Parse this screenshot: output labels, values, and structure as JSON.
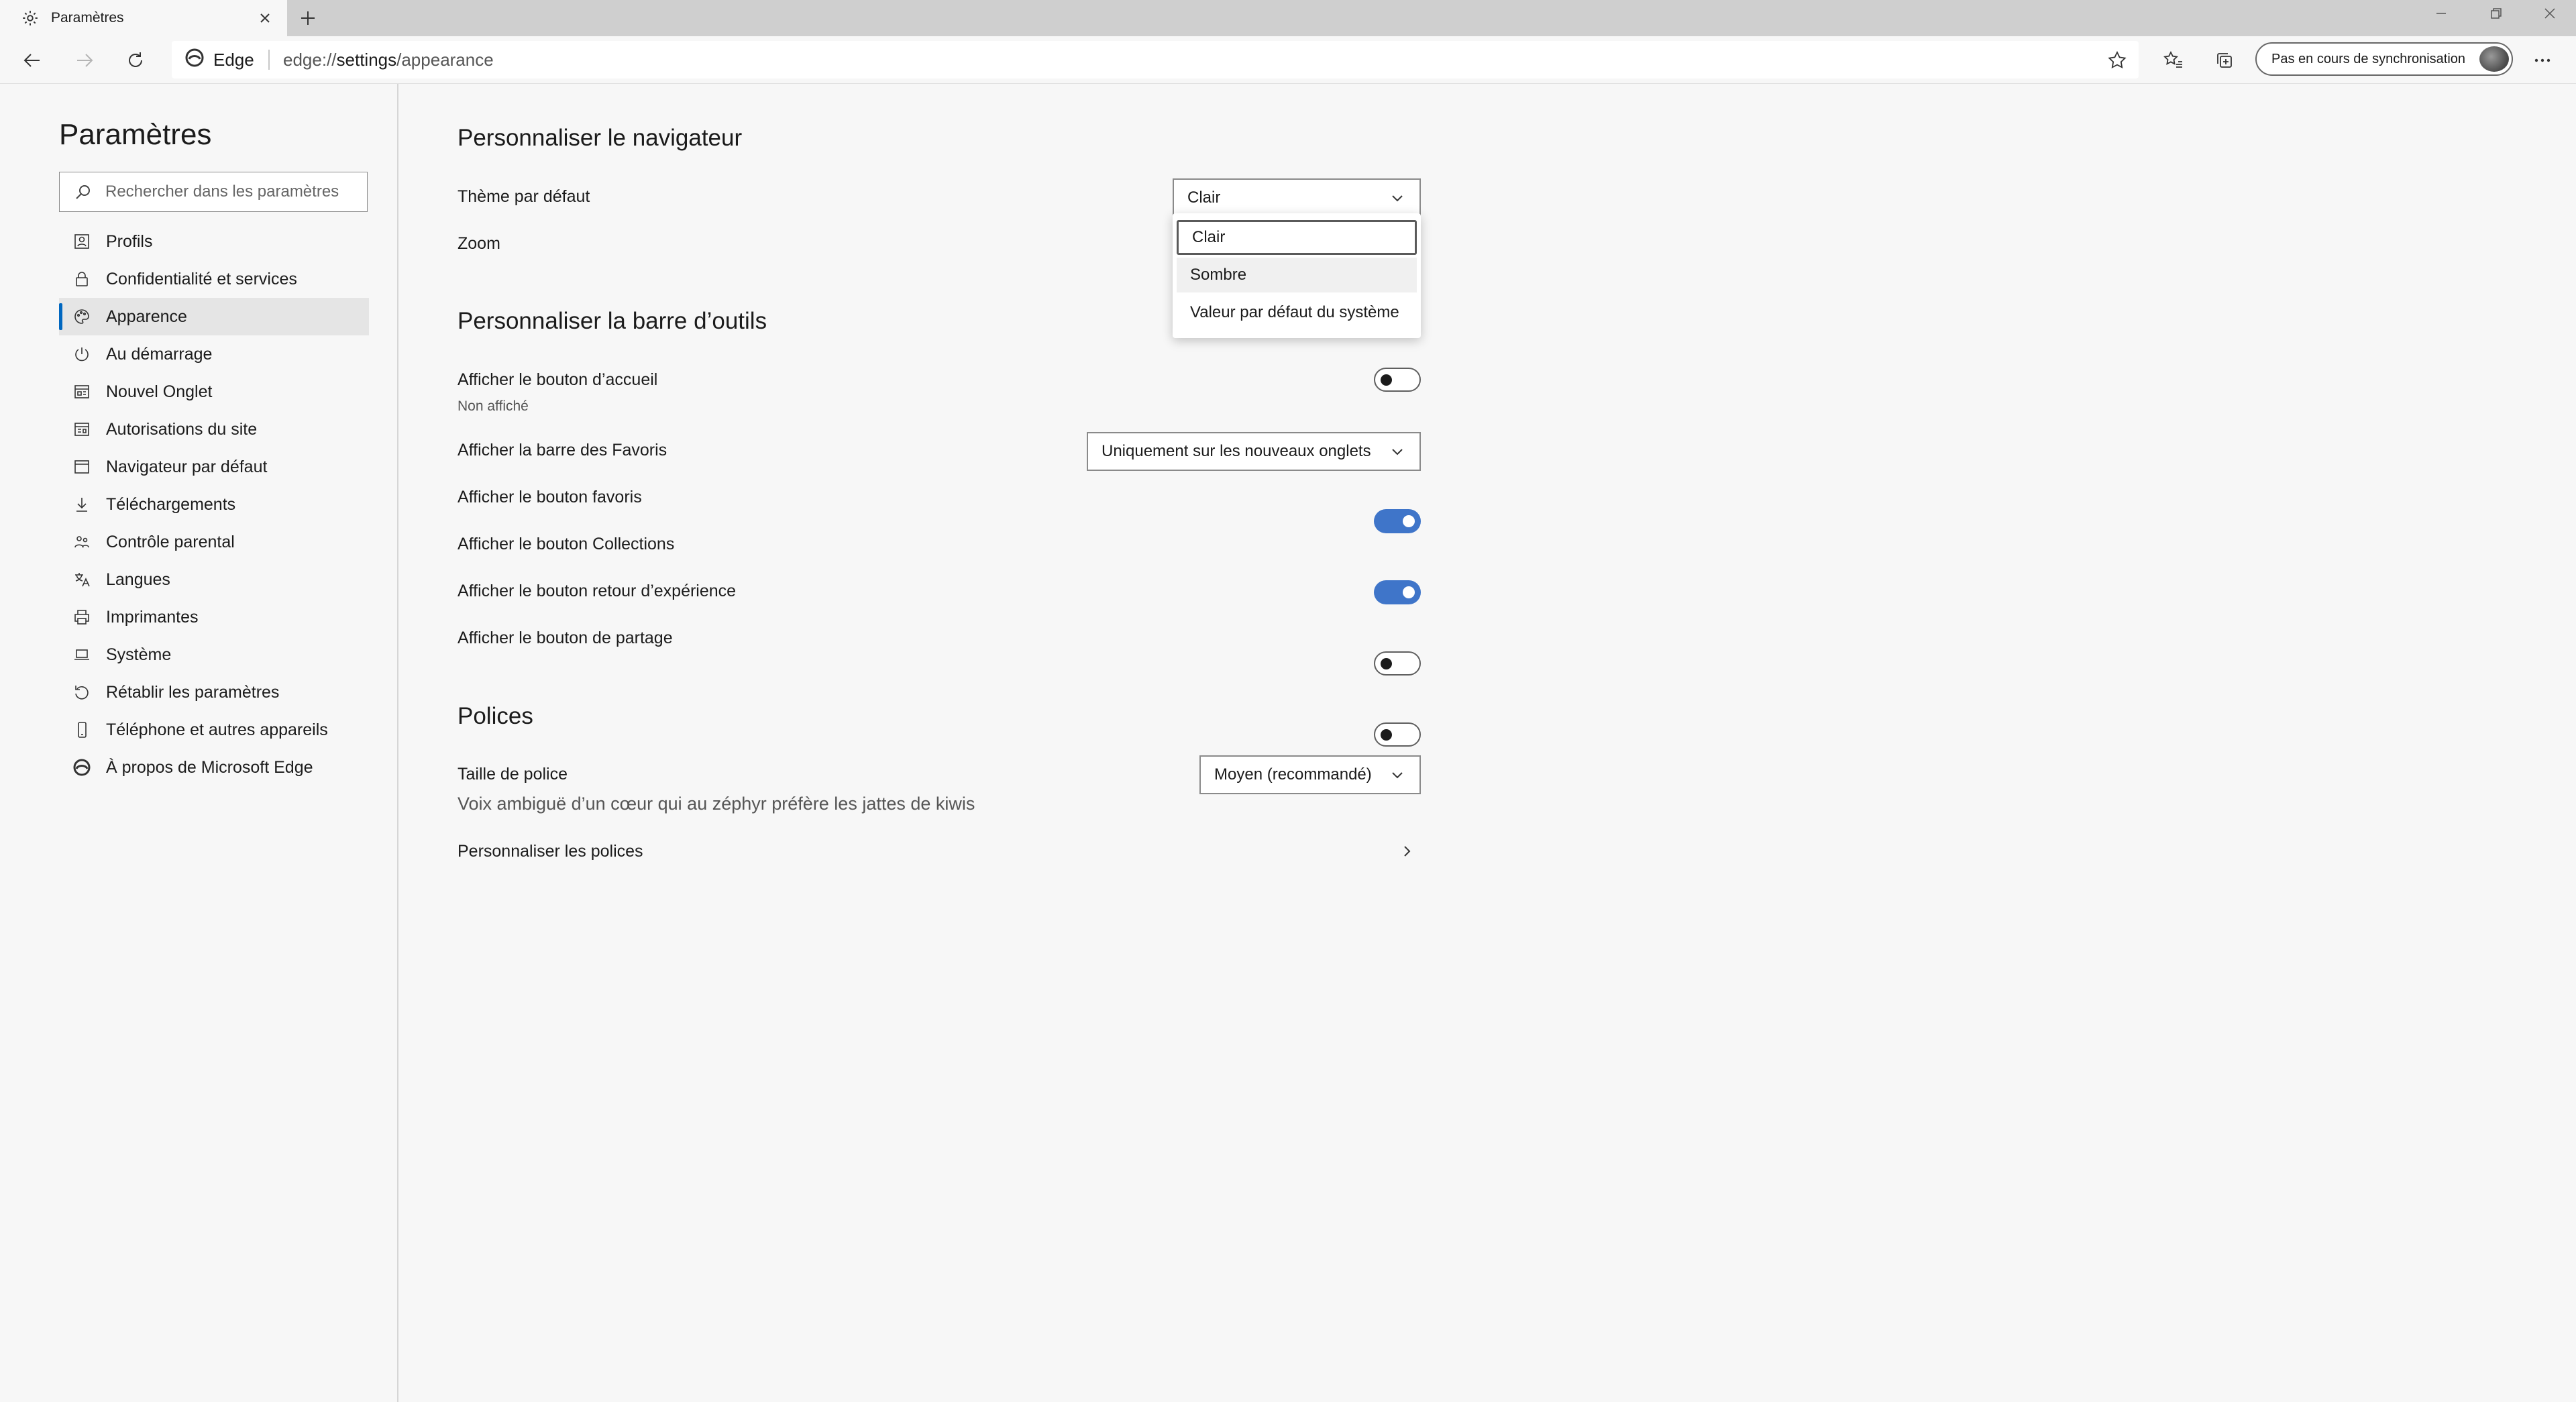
{
  "window": {
    "tab_title": "Paramètres",
    "new_tab_label": "+"
  },
  "navbar": {
    "browser_name": "Edge",
    "url_scheme": "edge://",
    "url_host": "settings",
    "url_path": "/appearance",
    "sync_label": "Pas en cours de synchronisation"
  },
  "sidebar": {
    "title": "Paramètres",
    "search_placeholder": "Rechercher dans les paramètres",
    "items": [
      {
        "label": "Profils",
        "icon": "profile-icon",
        "active": false
      },
      {
        "label": "Confidentialité et services",
        "icon": "lock-icon",
        "active": false
      },
      {
        "label": "Apparence",
        "icon": "palette-icon",
        "active": true
      },
      {
        "label": "Au démarrage",
        "icon": "power-icon",
        "active": false
      },
      {
        "label": "Nouvel Onglet",
        "icon": "new-tab-icon",
        "active": false
      },
      {
        "label": "Autorisations du site",
        "icon": "site-permissions-icon",
        "active": false
      },
      {
        "label": "Navigateur par défaut",
        "icon": "default-browser-icon",
        "active": false
      },
      {
        "label": "Téléchargements",
        "icon": "download-icon",
        "active": false
      },
      {
        "label": "Contrôle parental",
        "icon": "family-icon",
        "active": false
      },
      {
        "label": "Langues",
        "icon": "language-icon",
        "active": false
      },
      {
        "label": "Imprimantes",
        "icon": "printer-icon",
        "active": false
      },
      {
        "label": "Système",
        "icon": "system-icon",
        "active": false
      },
      {
        "label": "Rétablir les paramètres",
        "icon": "reset-icon",
        "active": false
      },
      {
        "label": "Téléphone et autres appareils",
        "icon": "phone-icon",
        "active": false
      },
      {
        "label": "À propos de Microsoft Edge",
        "icon": "edge-logo-icon",
        "active": false
      }
    ]
  },
  "main": {
    "section_browser": {
      "title": "Personnaliser le navigateur",
      "theme_label": "Thème par défaut",
      "theme_value": "Clair",
      "zoom_label": "Zoom",
      "theme_options": [
        "Clair",
        "Sombre",
        "Valeur par défaut du système"
      ]
    },
    "section_toolbar": {
      "title": "Personnaliser la barre d’outils",
      "home_label": "Afficher le bouton d’accueil",
      "home_sub": "Non affiché",
      "home_on": false,
      "favbar_label": "Afficher la barre des Favoris",
      "favbar_value": "Uniquement sur les nouveaux onglets",
      "favbtn_label": "Afficher le bouton favoris",
      "favbtn_on": true,
      "collections_label": "Afficher le bouton Collections",
      "collections_on": true,
      "feedback_label": "Afficher le bouton retour d’expérience",
      "feedback_on": false,
      "share_label": "Afficher le bouton de partage",
      "share_on": false
    },
    "section_fonts": {
      "title": "Polices",
      "size_label": "Taille de police",
      "size_value": "Moyen (recommandé)",
      "preview_text": "Voix ambiguë d’un cœur qui au zéphyr préfère les jattes de kiwis",
      "customize_label": "Personnaliser les polices"
    }
  },
  "colors": {
    "accent": "#0067c0",
    "toggle_on": "#3f75c9",
    "background": "#f7f7f7"
  }
}
